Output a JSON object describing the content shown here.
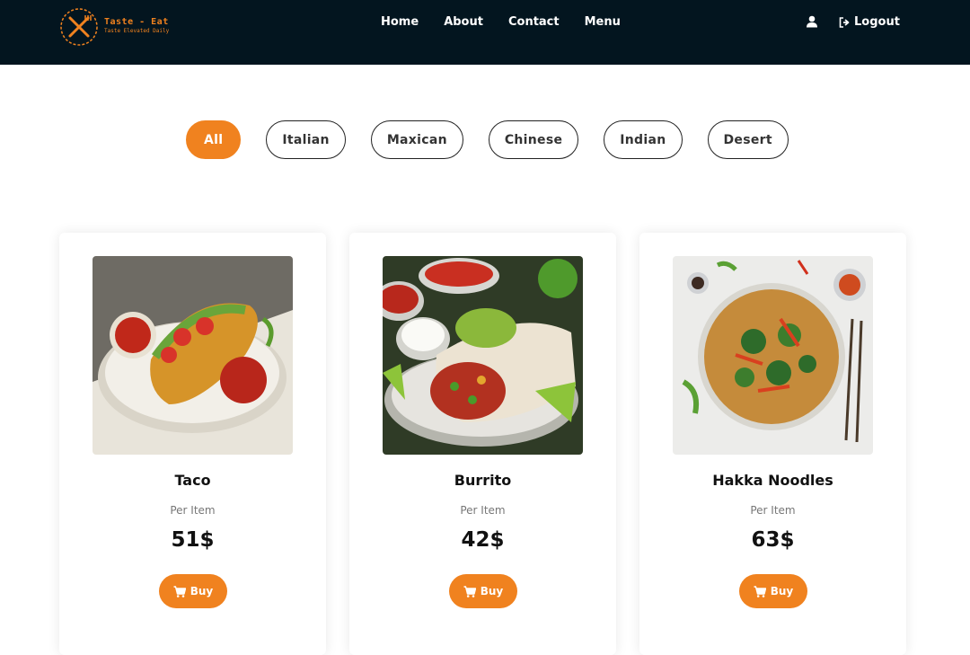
{
  "brand": {
    "name": "Taste - Eat",
    "tagline": "Taste Elevated Daily",
    "accent_color": "#f0821f",
    "nav_bg": "#03151f"
  },
  "nav": {
    "links": [
      "Home",
      "About",
      "Contact",
      "Menu"
    ],
    "user_icon": "user-icon",
    "logout_label": "Logout"
  },
  "filters": {
    "options": [
      "All",
      "Italian",
      "Maxican",
      "Chinese",
      "Indian",
      "Desert"
    ],
    "selected": "All"
  },
  "products": [
    {
      "name": "Taco",
      "per_label": "Per Item",
      "price": "51$",
      "buy_label": "Buy"
    },
    {
      "name": "Burrito",
      "per_label": "Per Item",
      "price": "42$",
      "buy_label": "Buy"
    },
    {
      "name": "Hakka Noodles",
      "per_label": "Per Item",
      "price": "63$",
      "buy_label": "Buy"
    }
  ]
}
